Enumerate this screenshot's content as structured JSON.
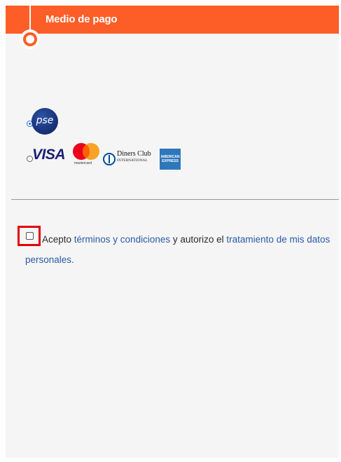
{
  "header": {
    "title": "Medio de pago",
    "color": "#fd5e27"
  },
  "payment_options": [
    {
      "name": "PSE",
      "selected": true,
      "logo_text": "pse"
    },
    {
      "name": "Cards",
      "selected": false,
      "logos": [
        "VISA",
        "mastercard",
        "Diners Club INTERNATIONAL",
        "AMERICAN EXPRESS"
      ]
    }
  ],
  "logos": {
    "visa": "VISA",
    "mastercard": "mastercard",
    "diners_line1": "Diners Club",
    "diners_line2": "INTERNATIONAL",
    "amex": "AMERICAN EXPRESS"
  },
  "terms": {
    "text_1": "Acepto ",
    "link_1": "términos y condiciones",
    "text_2": " y autorizo el ",
    "link_2": "tratamiento de mis datos personales.",
    "checked": false,
    "highlight_color": "#e3000b",
    "link_color": "#2a5aa8"
  }
}
